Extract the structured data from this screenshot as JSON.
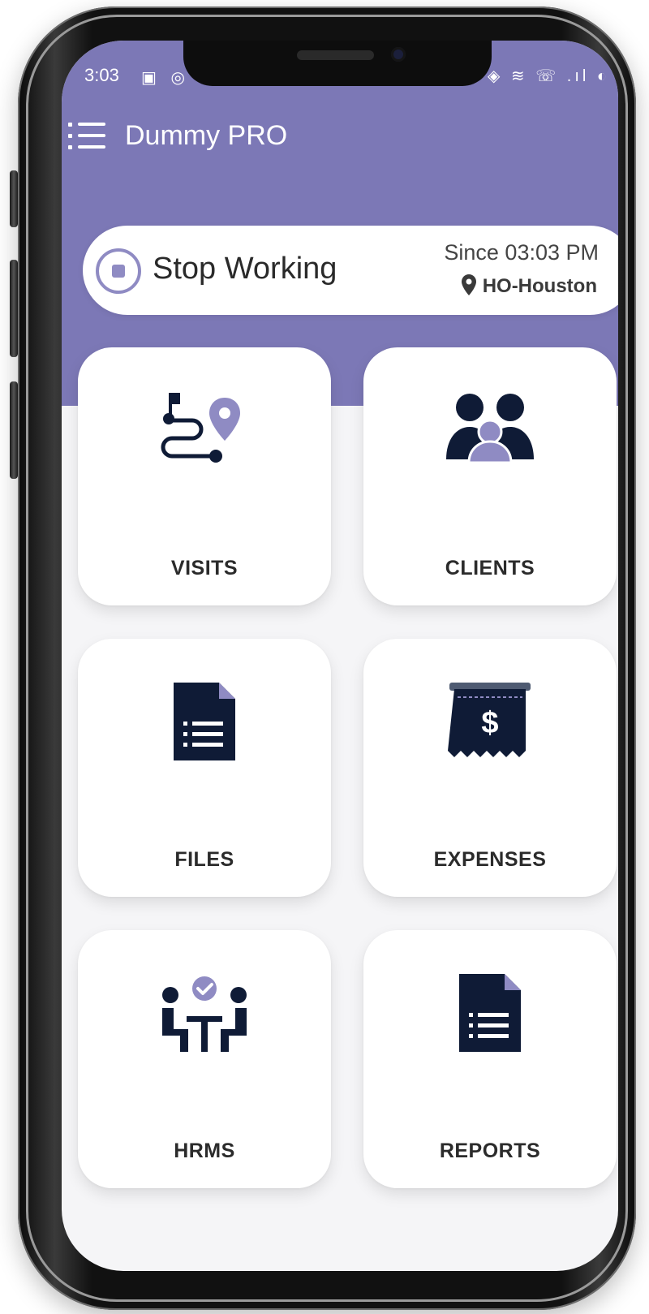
{
  "status_bar": {
    "time": "3:03",
    "left_icons": "▣ ◎",
    "right_icons": "◈ ≋ ☏ .ıl ◐"
  },
  "appbar": {
    "title": "Dummy PRO",
    "menu_icon": "menu-list-icon"
  },
  "work_status": {
    "button_label": "Stop Working",
    "since_text": "Since 03:03 PM",
    "location": "HO-Houston"
  },
  "tiles": [
    {
      "label": "VISITS",
      "icon": "route-map-pin-icon"
    },
    {
      "label": "CLIENTS",
      "icon": "users-group-icon"
    },
    {
      "label": "FILES",
      "icon": "document-list-icon"
    },
    {
      "label": "EXPENSES",
      "icon": "receipt-dollar-icon"
    },
    {
      "label": "HRMS",
      "icon": "meeting-people-check-icon"
    },
    {
      "label": "REPORTS",
      "icon": "report-document-icon"
    }
  ],
  "colors": {
    "header": "#7c78b6",
    "accent": "#8f8bc3",
    "icon_dark": "#0f1b36"
  }
}
